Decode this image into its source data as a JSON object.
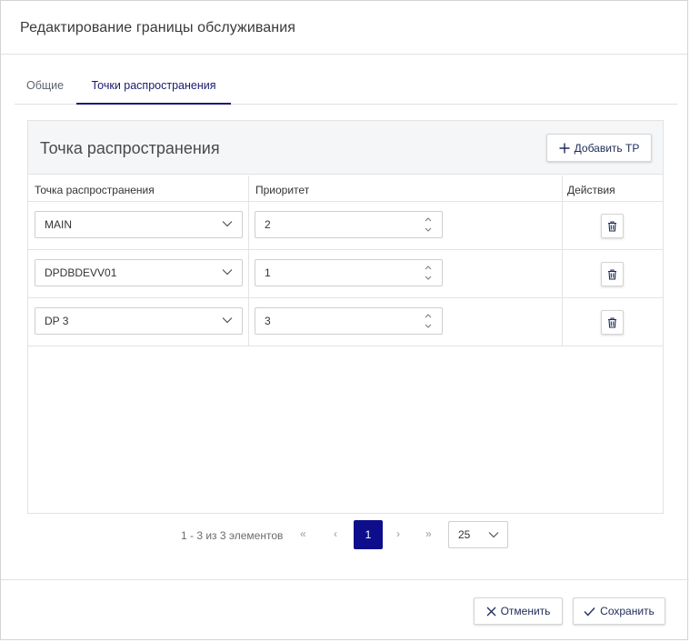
{
  "dialog": {
    "title": "Редактирование границы обслуживания"
  },
  "tabs": [
    {
      "label": "Общие",
      "active": false
    },
    {
      "label": "Точки распространения",
      "active": true
    }
  ],
  "panel": {
    "title": "Точка распространения",
    "add_button_label": "Добавить TP",
    "add_icon": "plus-icon"
  },
  "grid": {
    "columns": [
      "Точка распространения",
      "Приоритет",
      "Действия"
    ],
    "rows": [
      {
        "point": "MAIN",
        "priority": "2"
      },
      {
        "point": "DPDBDEVV01",
        "priority": "1"
      },
      {
        "point": "DP 3",
        "priority": "3"
      }
    ],
    "delete_icon": "trash-icon"
  },
  "pager": {
    "info": "1 - 3 из 3 элементов",
    "first": "«",
    "prev": "‹",
    "current_page": "1",
    "next": "›",
    "last": "»",
    "page_size": "25"
  },
  "footer": {
    "cancel_label": "Отменить",
    "save_label": "Сохранить",
    "cancel_icon": "x-icon",
    "save_icon": "check-icon"
  },
  "colors": {
    "accent": "#0e0e8c",
    "button_text": "#1e2a5a"
  }
}
